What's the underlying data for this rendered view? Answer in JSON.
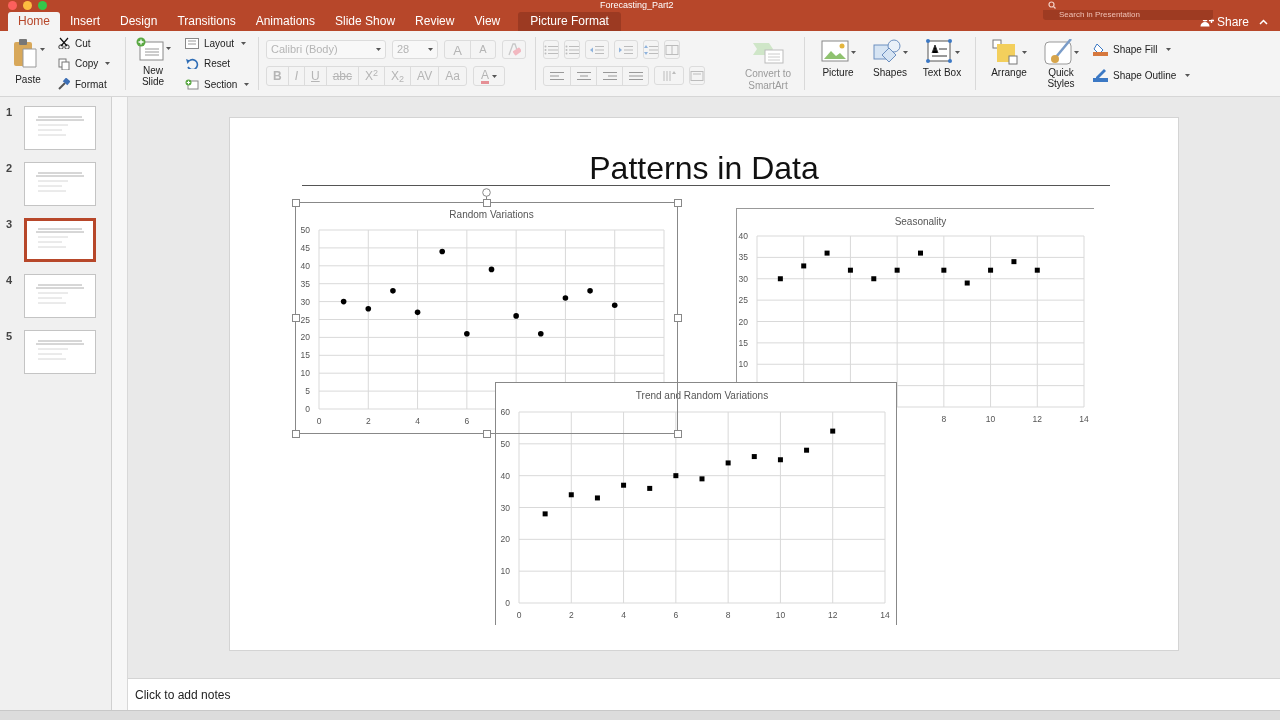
{
  "window": {
    "title": "Forecasting_Part2",
    "search": {
      "placeholder": "Search in Presentation"
    }
  },
  "tabs": [
    {
      "label": "Home",
      "selected": true,
      "kind": "normal"
    },
    {
      "label": "Insert",
      "selected": false,
      "kind": "normal"
    },
    {
      "label": "Design",
      "selected": false,
      "kind": "normal"
    },
    {
      "label": "Transitions",
      "selected": false,
      "kind": "normal"
    },
    {
      "label": "Animations",
      "selected": false,
      "kind": "normal"
    },
    {
      "label": "Slide Show",
      "selected": false,
      "kind": "normal"
    },
    {
      "label": "Review",
      "selected": false,
      "kind": "normal"
    },
    {
      "label": "View",
      "selected": false,
      "kind": "normal"
    },
    {
      "label": "Picture Format",
      "selected": false,
      "kind": "contextual"
    }
  ],
  "share": {
    "label": "Share"
  },
  "ribbon": {
    "paste": {
      "label": "Paste"
    },
    "clipboard": [
      {
        "kind": "cut",
        "label": "Cut",
        "dropdown": false
      },
      {
        "kind": "copy",
        "label": "Copy",
        "dropdown": true
      },
      {
        "kind": "format",
        "label": "Format",
        "dropdown": false
      }
    ],
    "new_slide": {
      "label": "New Slide"
    },
    "slides": [
      {
        "kind": "layout",
        "label": "Layout",
        "dropdown": true
      },
      {
        "kind": "reset",
        "label": "Reset",
        "dropdown": false
      },
      {
        "kind": "section",
        "label": "Section",
        "dropdown": true
      }
    ],
    "font": {
      "family": "Calibri (Body)",
      "size": "28",
      "grow": "A",
      "shrink": "A",
      "disabled": true,
      "styles": [
        {
          "kind": "bold",
          "label": "B"
        },
        {
          "kind": "italic",
          "label": "I"
        },
        {
          "kind": "underline",
          "label": "U"
        },
        {
          "kind": "strike",
          "label": "abc"
        },
        {
          "kind": "sup",
          "label": "X$^{2}$"
        },
        {
          "kind": "sub",
          "label": "X$_{2}$"
        },
        {
          "kind": "spacing",
          "label": "AV"
        },
        {
          "kind": "case",
          "label": "Aa"
        }
      ],
      "color": {
        "label": "A"
      }
    },
    "smartart": {
      "label": "Convert to SmartArt",
      "disabled": true
    },
    "insert": [
      {
        "kind": "picture",
        "label": "Picture"
      },
      {
        "kind": "shapes",
        "label": "Shapes"
      },
      {
        "kind": "textbox",
        "label": "Text Box"
      }
    ],
    "arrange": [
      {
        "kind": "arrange",
        "label": "Arrange"
      },
      {
        "kind": "styles",
        "label": "Quick Styles"
      }
    ],
    "shape_format": [
      {
        "kind": "fill",
        "label": "Shape Fill"
      },
      {
        "kind": "outline",
        "label": "Shape Outline"
      }
    ]
  },
  "thumbnails": [
    {
      "number": "1",
      "selected": false
    },
    {
      "number": "2",
      "selected": false
    },
    {
      "number": "3",
      "selected": true
    },
    {
      "number": "4",
      "selected": false
    },
    {
      "number": "5",
      "selected": false
    }
  ],
  "slide": {
    "title": "Patterns in Data",
    "charts": [
      {
        "kind": "dot",
        "chart_data": {
          "type": "scatter",
          "title": "Random Variations",
          "grid": true,
          "x": [
            1,
            2,
            3,
            4,
            5,
            6,
            7,
            8,
            9,
            10,
            11,
            12
          ],
          "series": [
            {
              "color": "#000000",
              "values": [
                30,
                28,
                33,
                27,
                44,
                21,
                39,
                26,
                21,
                31,
                33,
                29
              ]
            }
          ],
          "xlim": [
            0,
            14
          ],
          "ylim": [
            0,
            50
          ],
          "xticks": [
            0,
            2,
            4,
            6
          ],
          "yticks": [
            0,
            5,
            10,
            15,
            20,
            25,
            30,
            35,
            40,
            45,
            50
          ]
        }
      },
      {
        "kind": "square",
        "chart_data": {
          "type": "scatter",
          "title": "Seasonality",
          "grid": true,
          "x": [
            1,
            2,
            3,
            4,
            5,
            6,
            7,
            8,
            9,
            10,
            11,
            12
          ],
          "series": [
            {
              "color": "#000000",
              "values": [
                30,
                33,
                36,
                32,
                30,
                32,
                36,
                32,
                29,
                32,
                34,
                32
              ]
            }
          ],
          "xlim": [
            0,
            14
          ],
          "ylim": [
            0,
            40
          ],
          "xticks": [
            8,
            10,
            12,
            14
          ],
          "yticks": [
            10,
            15,
            20,
            25,
            30,
            35,
            40
          ]
        }
      },
      {
        "kind": "square",
        "chart_data": {
          "type": "scatter",
          "title": "Trend and Random Variations",
          "grid": true,
          "x": [
            1,
            2,
            3,
            4,
            5,
            6,
            7,
            8,
            9,
            10,
            11,
            12
          ],
          "series": [
            {
              "color": "#000000",
              "values": [
                28,
                34,
                33,
                37,
                36,
                40,
                39,
                44,
                46,
                45,
                48,
                54
              ]
            }
          ],
          "xlim": [
            0,
            14
          ],
          "ylim": [
            0,
            60
          ],
          "xticks": [
            0,
            2,
            4,
            6,
            8,
            10,
            12,
            14
          ],
          "yticks": [
            0,
            10,
            20,
            30,
            40,
            50,
            60
          ]
        }
      }
    ]
  },
  "notes": {
    "placeholder": "Click to add notes"
  }
}
